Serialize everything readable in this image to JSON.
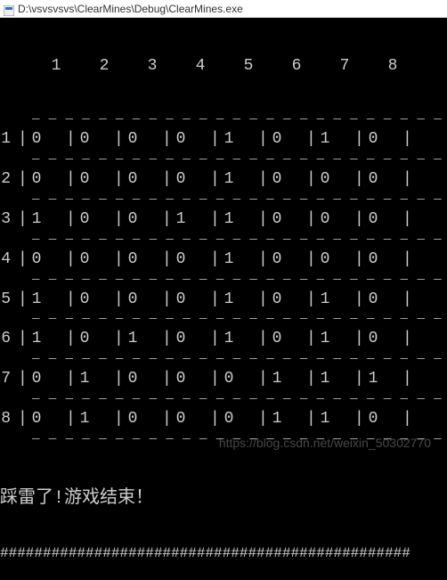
{
  "window": {
    "title": "D:\\vsvsvsvs\\ClearMines\\Debug\\ClearMines.exe"
  },
  "grid": {
    "col_headers": [
      "1",
      "2",
      "3",
      "4",
      "5",
      "6",
      "7",
      "8"
    ],
    "row_labels": [
      "1",
      "2",
      "3",
      "4",
      "5",
      "6",
      "7",
      "8"
    ],
    "rows": [
      [
        "0",
        "0",
        "0",
        "0",
        "1",
        "0",
        "1",
        "0"
      ],
      [
        "0",
        "0",
        "0",
        "0",
        "1",
        "0",
        "0",
        "0"
      ],
      [
        "1",
        "0",
        "0",
        "1",
        "1",
        "0",
        "0",
        "0"
      ],
      [
        "0",
        "0",
        "0",
        "0",
        "1",
        "0",
        "0",
        "0"
      ],
      [
        "1",
        "0",
        "0",
        "0",
        "1",
        "0",
        "1",
        "0"
      ],
      [
        "1",
        "0",
        "1",
        "0",
        "1",
        "0",
        "1",
        "0"
      ],
      [
        "0",
        "1",
        "0",
        "0",
        "0",
        "1",
        "1",
        "1"
      ],
      [
        "0",
        "1",
        "0",
        "0",
        "0",
        "1",
        "1",
        "0"
      ]
    ],
    "divider": "— — — — — — — — — — — — — — — — — — — — — — — — — —"
  },
  "messages": {
    "game_over": "踩雷了!游戏结束！",
    "hashline": "################################################"
  },
  "watermark": {
    "text": "https://blog.csdn.net/weixin_50302770"
  }
}
